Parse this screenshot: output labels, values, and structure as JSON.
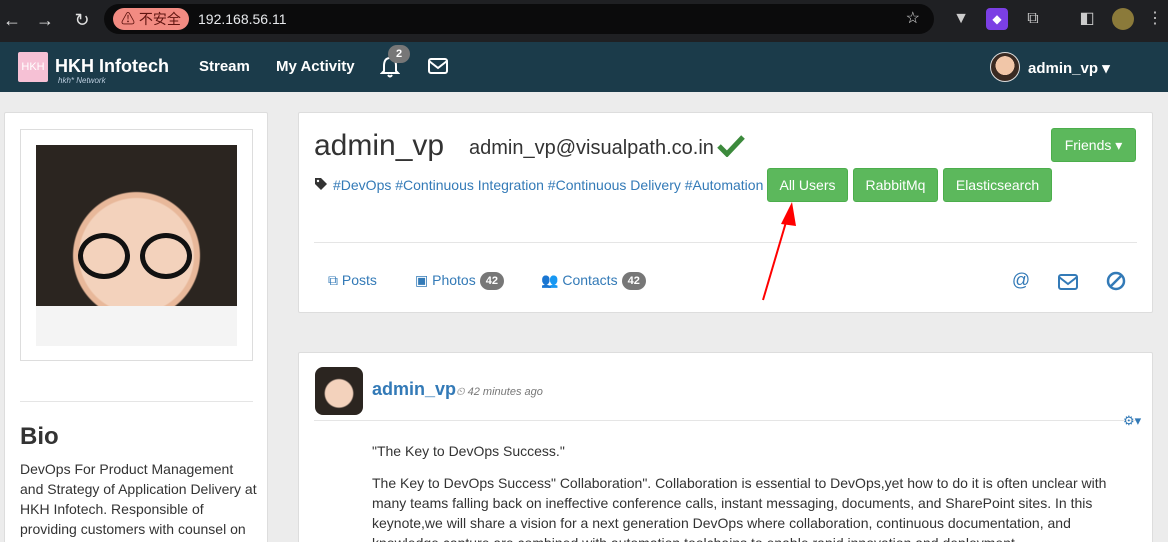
{
  "browser": {
    "security_label": "不安全",
    "url": "192.168.56.11"
  },
  "navbar": {
    "brand": "HKH Infotech",
    "brand_sub": "hkh* Network",
    "links": [
      "Stream",
      "My Activity"
    ],
    "notification_count": "2",
    "username": "admin_vp"
  },
  "left": {
    "bio_title": "Bio",
    "bio_text": "DevOps For Product Management and Strategy of Application Delivery at HKH Infotech. Responsible of providing customers with counsel on"
  },
  "profile": {
    "name": "admin_vp",
    "email": "admin_vp@visualpath.co.in",
    "tags": "#DevOps #Continuous Integration #Continuous Delivery #Automation",
    "buttons": [
      "All Users",
      "RabbitMq",
      "Elasticsearch"
    ],
    "friends_label": "Friends",
    "tabs": {
      "posts": "Posts",
      "photos": "Photos",
      "photos_count": "42",
      "contacts": "Contacts",
      "contacts_count": "42"
    }
  },
  "post": {
    "author": "admin_vp",
    "time": "42 minutes ago",
    "title": "\"The Key to DevOps Success.\"",
    "body": "The Key to DevOps Success\" Collaboration\". Collaboration is essential to DevOps,yet how to do it is often unclear with many teams falling back on ineffective conference calls, instant messaging, documents, and SharePoint sites. In this keynote,we will share a vision for a next generation DevOps where collaboration, continuous documentation, and knowledge capture are combined with automation toolchains to enable rapid innovation and deployment."
  },
  "colors": {
    "navbar": "#1b3b4a",
    "link": "#337ab7",
    "green": "#5cb85c",
    "annotation": "#ff0000"
  }
}
